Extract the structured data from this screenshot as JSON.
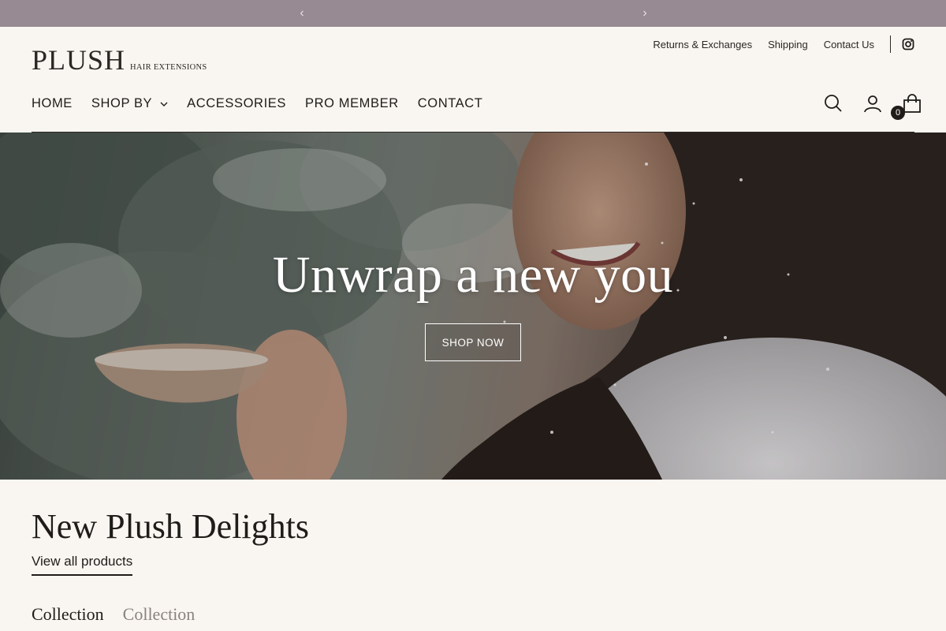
{
  "announcement": {
    "prev_label": "‹",
    "next_label": "›",
    "message": ""
  },
  "brand": {
    "name": "PLUSH",
    "tagline": "HAIR EXTENSIONS"
  },
  "utility_links": [
    {
      "label": "Returns & Exchanges"
    },
    {
      "label": "Shipping"
    },
    {
      "label": "Contact Us"
    }
  ],
  "nav": {
    "items": [
      {
        "label": "HOME"
      },
      {
        "label": "SHOP BY"
      },
      {
        "label": "ACCESSORIES"
      },
      {
        "label": "PRO MEMBER"
      },
      {
        "label": "CONTACT"
      }
    ]
  },
  "cart": {
    "count": "0"
  },
  "hero": {
    "title": "Unwrap a new you",
    "button_label": "SHOP NOW"
  },
  "collection_section": {
    "title": "New Plush Delights",
    "view_all_label": "View all products",
    "tabs": [
      {
        "label": "Collection"
      },
      {
        "label": "Collection"
      }
    ]
  },
  "colors": {
    "announcement_bg": "#978a92",
    "page_bg": "#f9f6f1",
    "text": "#1f1c19"
  },
  "icons": [
    "chevron-left-icon",
    "chevron-right-icon",
    "instagram-icon",
    "chevron-down-icon",
    "search-icon",
    "account-icon",
    "shopping-bag-icon"
  ]
}
